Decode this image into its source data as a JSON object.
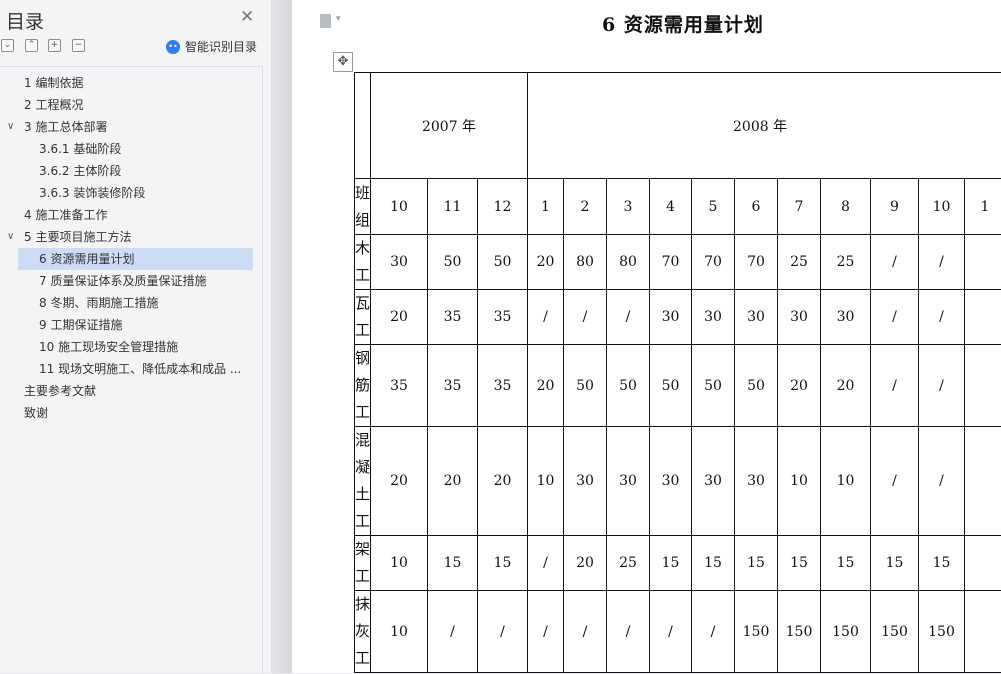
{
  "sidebar": {
    "title": "目录",
    "smart_toc_label": "智能识别目录",
    "items": [
      {
        "label": "1   编制依据",
        "level": 1,
        "chevron": ""
      },
      {
        "label": "2   工程概况",
        "level": 1,
        "chevron": ""
      },
      {
        "label": "3   施工总体部署",
        "level": 1,
        "chevron": "∨"
      },
      {
        "label": "3.6.1  基础阶段",
        "level": 2,
        "chevron": ""
      },
      {
        "label": "3.6.2  主体阶段",
        "level": 2,
        "chevron": ""
      },
      {
        "label": "3.6.3  装饰装修阶段",
        "level": 2,
        "chevron": ""
      },
      {
        "label": "4   施工准备工作",
        "level": 1,
        "chevron": ""
      },
      {
        "label": "5   主要项目施工方法",
        "level": 1,
        "chevron": "∨"
      },
      {
        "label": "6   资源需用量计划",
        "level": 2,
        "chevron": "",
        "active": true
      },
      {
        "label": "7   质量保证体系及质量保证措施",
        "level": 2,
        "chevron": ""
      },
      {
        "label": "8   冬期、雨期施工措施",
        "level": 2,
        "chevron": ""
      },
      {
        "label": "9   工期保证措施",
        "level": 2,
        "chevron": ""
      },
      {
        "label": "10   施工现场安全管理措施",
        "level": 2,
        "chevron": ""
      },
      {
        "label": "11   现场文明施工、降低成本和成品 ...",
        "level": 2,
        "chevron": ""
      },
      {
        "label": "主要参考文献",
        "level": 1,
        "chevron": ""
      },
      {
        "label": "致谢",
        "level": 1,
        "chevron": ""
      }
    ]
  },
  "document": {
    "heading": "6   资源需用量计划",
    "table": {
      "year_2007": "2007 年",
      "year_2008": "2008 年",
      "crew_header": [
        "班",
        "组"
      ],
      "months": [
        "10",
        "11",
        "12",
        "1",
        "2",
        "3",
        "4",
        "5",
        "6",
        "7",
        "8",
        "9",
        "10",
        "1"
      ],
      "rows": [
        {
          "crew": [
            "木",
            "工"
          ],
          "values": [
            "30",
            "50",
            "50",
            "20",
            "80",
            "80",
            "70",
            "70",
            "70",
            "25",
            "25",
            "/",
            "/",
            ""
          ]
        },
        {
          "crew": [
            "瓦",
            "工"
          ],
          "values": [
            "20",
            "35",
            "35",
            "/",
            "/",
            "/",
            "30",
            "30",
            "30",
            "30",
            "30",
            "/",
            "/",
            ""
          ]
        },
        {
          "crew": [
            "钢",
            "筋",
            "工"
          ],
          "values": [
            "35",
            "35",
            "35",
            "20",
            "50",
            "50",
            "50",
            "50",
            "50",
            "20",
            "20",
            "/",
            "/",
            ""
          ]
        },
        {
          "crew": [
            "混",
            "凝",
            "土",
            "工"
          ],
          "values": [
            "20",
            "20",
            "20",
            "10",
            "30",
            "30",
            "30",
            "30",
            "30",
            "10",
            "10",
            "/",
            "/",
            ""
          ]
        },
        {
          "crew": [
            "架",
            "工"
          ],
          "values": [
            "10",
            "15",
            "15",
            "/",
            "20",
            "25",
            "15",
            "15",
            "15",
            "15",
            "15",
            "15",
            "15",
            ""
          ]
        },
        {
          "crew": [
            "抹",
            "灰",
            "工"
          ],
          "values": [
            "10",
            "/",
            "/",
            "/",
            "/",
            "/",
            "/",
            "/",
            "150",
            "150",
            "150",
            "150",
            "150",
            ""
          ]
        }
      ]
    }
  }
}
